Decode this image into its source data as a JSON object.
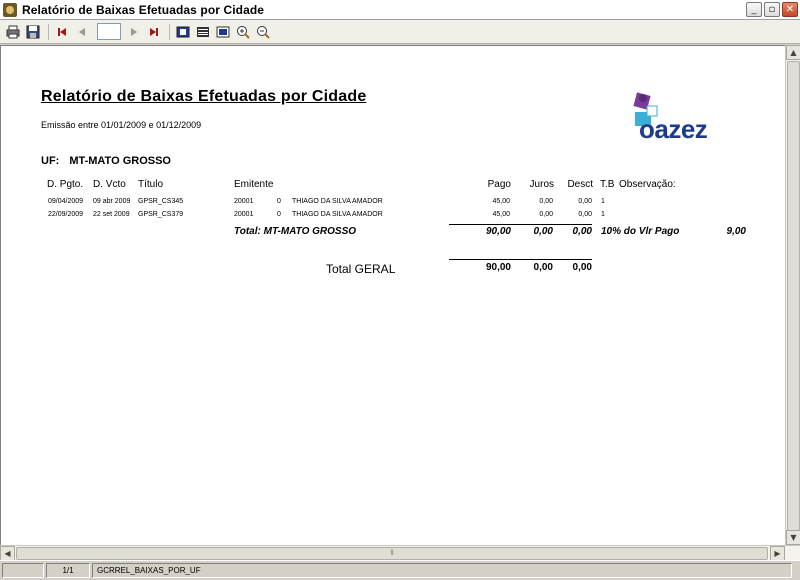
{
  "window": {
    "title": "Relatório de Baixas Efetuadas por Cidade",
    "controls": [
      "_",
      "▫",
      "✕"
    ]
  },
  "toolbar": {
    "page_value": ""
  },
  "report": {
    "title": "Relatório de Baixas Efetuadas por Cidade",
    "emission": "Emissão entre 01/01/2009 e 01/12/2009",
    "logo_text": "oazez",
    "uf_label": "UF:",
    "uf_value": "MT-MATO GROSSO",
    "headers": {
      "d_pgto": "D. Pgto.",
      "d_vcto": "D. Vcto",
      "titulo": "Título",
      "emitente": "Emitente",
      "pago": "Pago",
      "juros": "Juros",
      "desct": "Desct",
      "tb": "T.B",
      "observacao": "Observação:"
    },
    "rows": [
      {
        "d_pgto": "09/04/2009",
        "d_vcto": "09 abr 2009",
        "titulo": "GPSR_CS345",
        "emitente_code": "20001",
        "emitente_seq": "0",
        "emitente_name": "THIAGO DA SILVA AMADOR",
        "pago": "45,00",
        "juros": "0,00",
        "desct": "0,00",
        "tb": "1"
      },
      {
        "d_pgto": "22/09/2009",
        "d_vcto": "22 set 2009",
        "titulo": "GPSR_CS379",
        "emitente_code": "20001",
        "emitente_seq": "0",
        "emitente_name": "THIAGO DA SILVA AMADOR",
        "pago": "45,00",
        "juros": "0,00",
        "desct": "0,00",
        "tb": "1"
      }
    ],
    "subtotal": {
      "label": "Total:  MT-MATO GROSSO",
      "pago": "90,00",
      "juros": "0,00",
      "desct": "0,00",
      "obs_label": "10% do Vlr Pago",
      "obs_value": "9,00"
    },
    "grand_total": {
      "label": "Total GERAL",
      "pago": "90,00",
      "juros": "0,00",
      "desct": "0,00"
    }
  },
  "scrollbar": {
    "grip": "⦀"
  },
  "status": {
    "page": "1/1",
    "report_name": "GCRREL_BAIXAS_POR_UF"
  }
}
